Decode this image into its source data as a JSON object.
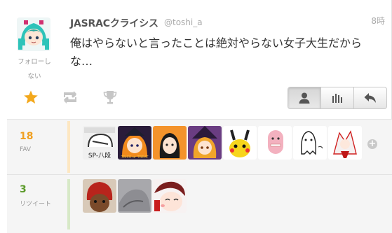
{
  "tweet": {
    "display_name": "JASRACクライシス",
    "handle": "@toshi_a",
    "time": "8時",
    "text": "俺はやらないと言ったことは絶対やらない女子大生だから な…"
  },
  "profile": {
    "follow_status_line1": "フォローし",
    "follow_status_line2": "ない"
  },
  "actions": [
    {
      "name": "favorite",
      "icon": "star-icon",
      "active": true
    },
    {
      "name": "retweet",
      "icon": "retweet-icon",
      "active": false
    },
    {
      "name": "trophy",
      "icon": "trophy-icon",
      "active": false
    }
  ],
  "view_buttons": [
    {
      "name": "user-view",
      "icon": "user-icon",
      "active": true
    },
    {
      "name": "stats-view",
      "icon": "bar-chart-icon",
      "active": false
    },
    {
      "name": "reply",
      "icon": "reply-icon",
      "active": false
    }
  ],
  "favorites": {
    "count": "18",
    "label": "FAV",
    "accent": "#f0a020",
    "thumb_texts": [
      "SP-八段",
      "TRICK or TREAT"
    ]
  },
  "retweets": {
    "count": "3",
    "label": "リツイート",
    "accent": "#5b9a2a"
  },
  "more_icon": "+"
}
